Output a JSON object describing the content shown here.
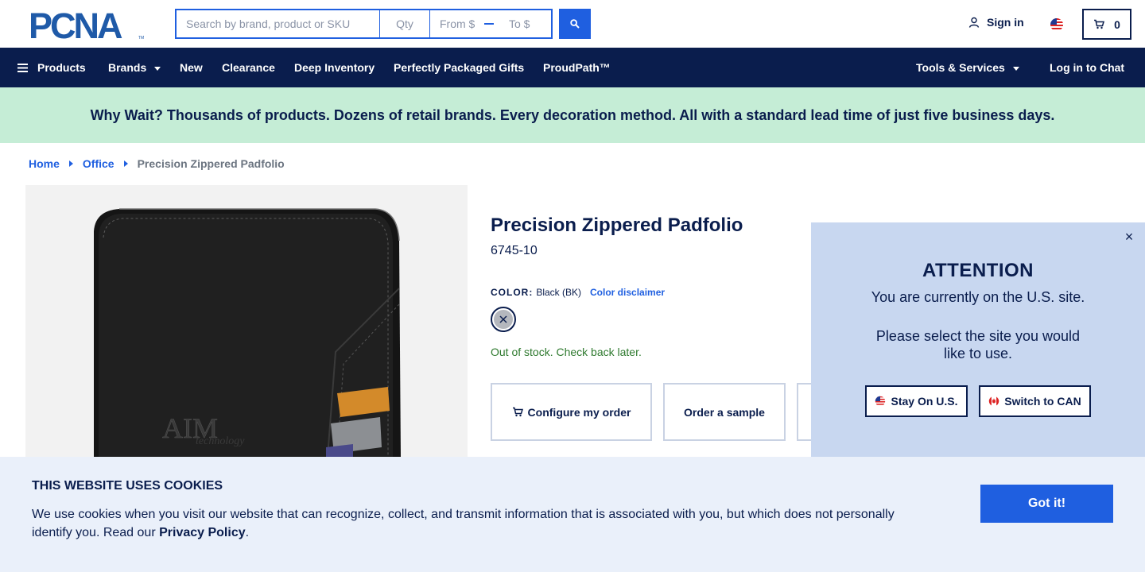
{
  "brand": {
    "logo_text": "PCNA",
    "trademark": "TM"
  },
  "search": {
    "placeholder": "Search by brand, product or SKU",
    "qty_placeholder": "Qty",
    "from_placeholder": "From $",
    "to_placeholder": "To $",
    "button_icon": "search-icon"
  },
  "header": {
    "sign_in": "Sign in",
    "cart_count": "0",
    "country_flag": "us-flag-icon"
  },
  "nav": {
    "products": "Products",
    "brands": "Brands",
    "new": "New",
    "clearance": "Clearance",
    "deep_inventory": "Deep Inventory",
    "gifts": "Perfectly Packaged Gifts",
    "proudpath": "ProudPath™",
    "tools": "Tools & Services",
    "chat": "Log in to Chat"
  },
  "promo": {
    "text": "Why Wait? Thousands of products. Dozens of retail brands. Every decoration method. All with a standard lead time of just five business days."
  },
  "breadcrumb": {
    "home": "Home",
    "office": "Office",
    "current": "Precision Zippered Padfolio"
  },
  "product": {
    "title": "Precision Zippered Padfolio",
    "sku": "6745-10",
    "color_label": "COLOR:",
    "color_value": "Black (BK)",
    "color_disclaimer": "Color disclaimer",
    "stock_status": "Out of stock. Check back later.",
    "image_logo": "AIM",
    "image_logo_sub": "technology",
    "actions": {
      "configure": "Configure my order",
      "sample": "Order a sample"
    }
  },
  "country_modal": {
    "title": "ATTENTION",
    "line1": "You are currently on the U.S. site.",
    "line2": "Please select the site you would like to use.",
    "stay": "Stay On U.S.",
    "switch": "Switch to CAN",
    "close": "×"
  },
  "cookie": {
    "title": "THIS WEBSITE USES COOKIES",
    "text": "We use cookies when you visit our website that can recognize, collect, and transmit information that is associated with you, but which does not personally identify you. Read our ",
    "link": "Privacy Policy",
    "end": ".",
    "button": "Got it!"
  },
  "colors": {
    "navy": "#0a1d4d",
    "blue": "#1f5fe0",
    "promo_bg": "#c5edd6",
    "modal_bg": "#c8d7f0",
    "cookie_bg": "#eaf0fa"
  }
}
